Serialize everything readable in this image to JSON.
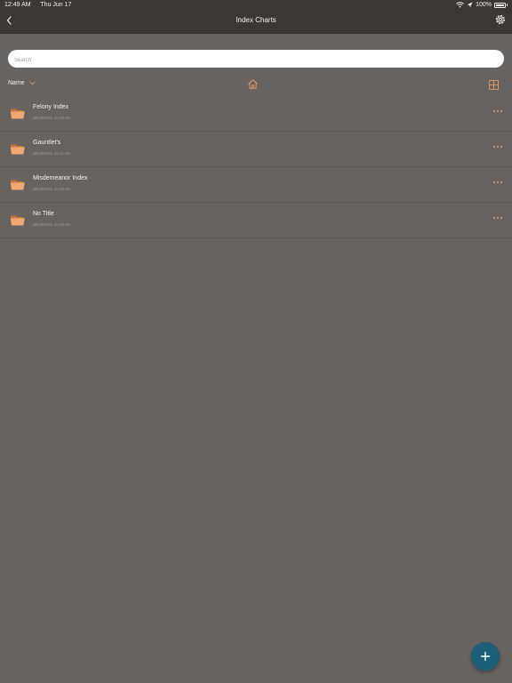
{
  "status_bar": {
    "time": "12:49 AM",
    "date": "Thu Jun 17",
    "battery": "100%",
    "icons": [
      "wifi-icon",
      "location-icon",
      "battery-icon"
    ]
  },
  "nav": {
    "title": "Index Charts",
    "back_icon": "chevron-left-icon",
    "settings_icon": "gear-icon"
  },
  "search": {
    "placeholder": "Search",
    "value": ""
  },
  "toolbar": {
    "sort_label": "Name",
    "sort_icon": "chevron-down-icon",
    "home_icon": "home-icon",
    "view_icon": "grid-icon"
  },
  "files": [
    {
      "name": "Felony Index",
      "date": "06/08/2021 10:30 am"
    },
    {
      "name": "Gauntlet's",
      "date": "06/08/2021 10:31 am"
    },
    {
      "name": "Misdemeanor Index",
      "date": "06/08/2021 10:30 am"
    },
    {
      "name": "No Title",
      "date": "06/08/2021 10:33 am"
    }
  ],
  "fab": {
    "icon": "plus-icon"
  },
  "colors": {
    "background": "#676360",
    "nav_background": "#3a3836",
    "accent_orange": "#e39a62",
    "fab_blue": "#1c5f78"
  }
}
